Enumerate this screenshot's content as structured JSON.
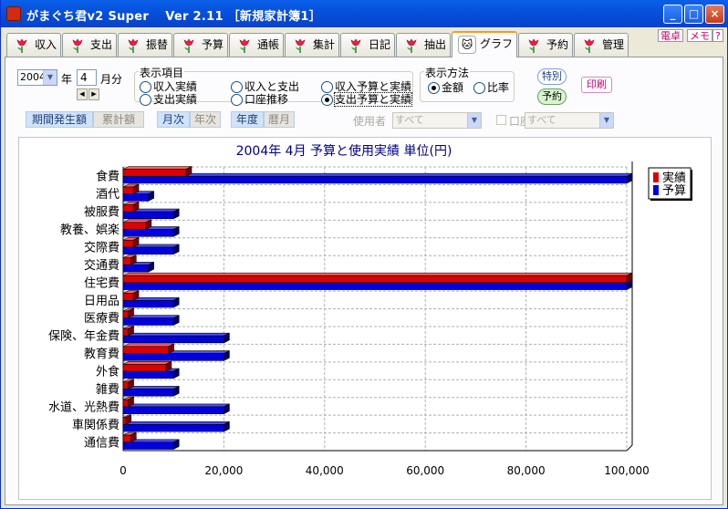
{
  "window": {
    "title": "がまぐち君v2 Super　 Ver 2.11 ［新規家計簿1］",
    "minimize": "_",
    "maximize": "□",
    "close": "×"
  },
  "tabs": [
    {
      "label": "収入"
    },
    {
      "label": "支出"
    },
    {
      "label": "振替"
    },
    {
      "label": "予算"
    },
    {
      "label": "通帳"
    },
    {
      "label": "集計"
    },
    {
      "label": "日記"
    },
    {
      "label": "抽出"
    },
    {
      "label": "グラフ"
    },
    {
      "label": "予約"
    },
    {
      "label": "管理"
    }
  ],
  "minitabs": {
    "dentaku": "電卓",
    "memo": "メモ",
    "help": "?"
  },
  "controls": {
    "year": "2004",
    "year_label": "年",
    "month": "4",
    "month_label": "月分",
    "display_group": "表示項目",
    "display_options": [
      {
        "label": "収入実績",
        "selected": false
      },
      {
        "label": "支出実績",
        "selected": false
      },
      {
        "label": "収入と支出",
        "selected": false
      },
      {
        "label": "口座推移",
        "selected": false
      },
      {
        "label": "収入予算と実績",
        "selected": false
      },
      {
        "label": "支出予算と実績",
        "selected": true
      }
    ],
    "method_group": "表示方法",
    "method_options": [
      {
        "label": "金額",
        "selected": true
      },
      {
        "label": "比率",
        "selected": false
      }
    ],
    "tokubetsu": "特別",
    "yoyaku": "予約",
    "print": "印刷",
    "period_occur": "期間発生額",
    "cumulative": "累計額",
    "monthly": "月次",
    "yearly": "年次",
    "fiscal": "年度",
    "calendar": "暦月",
    "user_label": "使用者",
    "user_value": "すべて",
    "account_label": "口座",
    "account_value": "すべて"
  },
  "colors": {
    "actual": "#dd0000",
    "budget": "#0000dd"
  },
  "chart_data": {
    "type": "bar",
    "orientation": "horizontal",
    "title": "2004年 4月 予算と使用実績  単位(円)",
    "categories": [
      "食費",
      "酒代",
      "被服費",
      "教養、娯楽",
      "交際費",
      "交通費",
      "住宅費",
      "日用品",
      "医療費",
      "保険、年金費",
      "教育費",
      "外食",
      "雑費",
      "水道、光熱費",
      "車関係費",
      "通信費"
    ],
    "series": [
      {
        "name": "実績",
        "values": [
          12500,
          2000,
          2000,
          4500,
          2000,
          1500,
          100000,
          2000,
          1000,
          1000,
          9000,
          8500,
          1000,
          1000,
          500,
          1500
        ]
      },
      {
        "name": "予算",
        "values": [
          100000,
          5000,
          10000,
          10000,
          10000,
          5000,
          100000,
          10000,
          10000,
          20000,
          20000,
          10000,
          10000,
          20000,
          20000,
          10000
        ]
      }
    ],
    "xlim": [
      0,
      100000
    ],
    "xticks": [
      "0",
      "20,000",
      "40,000",
      "60,000",
      "80,000",
      "100,000"
    ],
    "grid": true,
    "legend": "top-right"
  }
}
